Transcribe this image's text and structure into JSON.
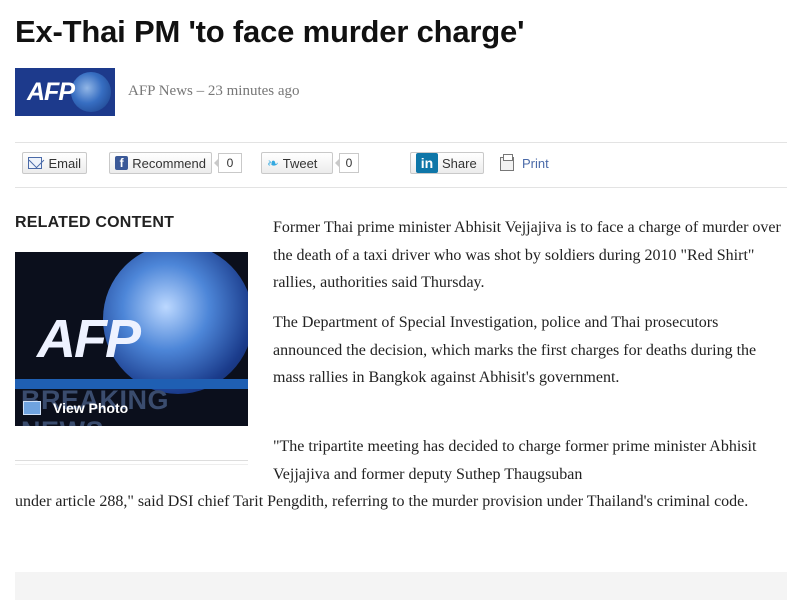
{
  "article": {
    "headline": "Ex-Thai PM 'to face murder charge'",
    "source_logo_text": "AFP",
    "byline": "AFP News – 23 minutes ago"
  },
  "share": {
    "email_label": "Email",
    "recommend_label": "Recommend",
    "recommend_count": "0",
    "tweet_label": "Tweet",
    "tweet_count": "0",
    "linkedin_label": "Share",
    "print_label": "Print"
  },
  "related": {
    "title": "RELATED CONTENT",
    "photo_logo_text": "AFP",
    "photo_banner_text": "BREAKING NEWS",
    "view_photo_label": "View Photo"
  },
  "body": {
    "p1": "Former Thai prime minister Abhisit Vejjajiva is to face a charge of murder over the death of a taxi driver who was shot by soldiers during 2010 \"Red Shirt\" rallies, authorities said Thursday.",
    "p2": "The Department of Special Investigation, police and Thai prosecutors announced the decision, which marks the first charges for deaths during the mass rallies in Bangkok against Abhisit's government.",
    "p3": "\"The tripartite meeting has decided to charge former prime minister Abhisit Vejjajiva and former deputy Suthep Thaugsuban",
    "p4": "under article 288,\" said DSI chief Tarit Pengdith, referring to the murder provision under Thailand's criminal code."
  },
  "icons": {
    "email": "envelope-icon",
    "recommend": "facebook-icon",
    "tweet": "twitter-bird-icon",
    "linkedin": "linkedin-icon",
    "print": "printer-icon",
    "view_photo": "photo-icon"
  },
  "colors": {
    "afp_blue": "#1d3a8c",
    "link_blue": "#4a6aa8",
    "facebook": "#3b5998",
    "linkedin": "#0e76a8"
  }
}
